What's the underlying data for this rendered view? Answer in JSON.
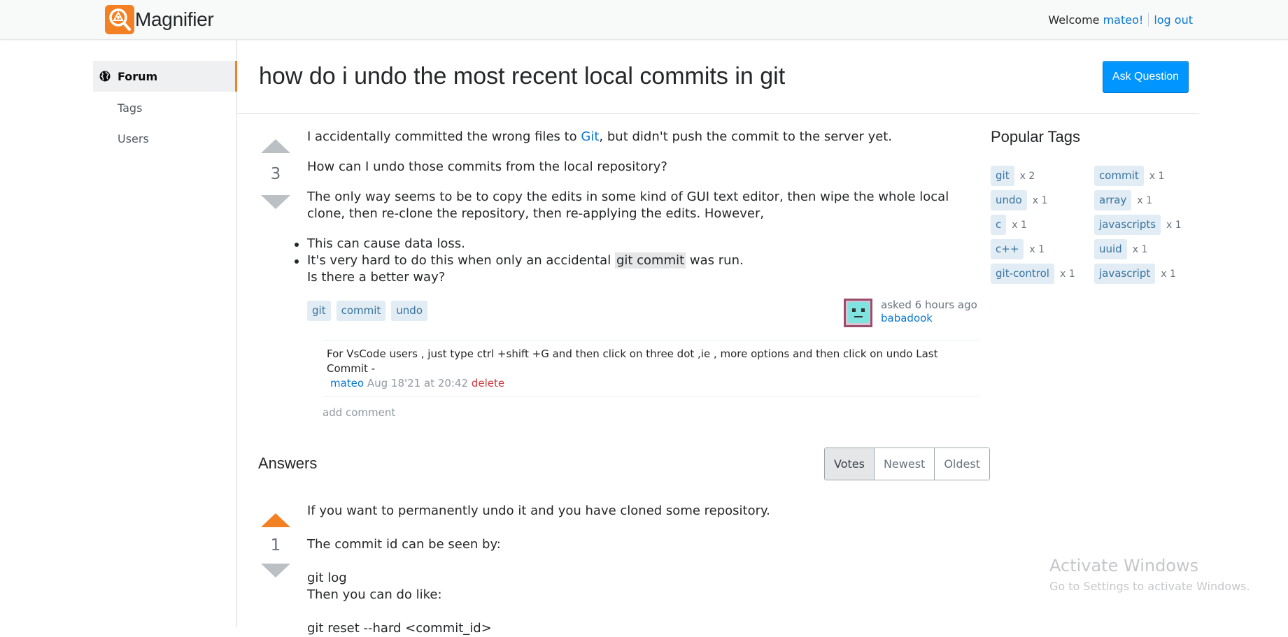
{
  "header": {
    "brand": "Magnifier",
    "welcome": "Welcome",
    "username": "mateo!",
    "logout": "log out"
  },
  "sidebar": {
    "items": [
      {
        "label": "Forum",
        "icon": "globe-icon",
        "active": true
      },
      {
        "label": "Tags",
        "active": false
      },
      {
        "label": "Users",
        "active": false
      }
    ]
  },
  "question": {
    "title": "how do i undo the most recent local commits in git",
    "ask_button": "Ask Question",
    "votes": "3",
    "body": {
      "p1_before": "I accidentally committed the wrong files to ",
      "p1_link": "Git",
      "p1_after": ", but didn't push the commit to the server yet.",
      "p2": "How can I undo those commits from the local repository?",
      "p3": "The only way seems to be to copy the edits in some kind of GUI text editor, then wipe the whole local clone, then re-clone the repository, then re-applying the edits. However,",
      "li1": "This can cause data loss.",
      "li2_before": "It's very hard to do this when only an accidental ",
      "li2_code": "git commit",
      "li2_after": " was run.",
      "li2_line2": "Is there a better way?"
    },
    "tags": [
      "git",
      "commit",
      "undo"
    ],
    "asked": "asked 6 hours ago",
    "author": "babadook",
    "comment": {
      "text": "For VsCode users , just type ctrl +shift +G and then click on three dot ,ie , more options and then click on undo Last Commit -",
      "user": "mateo",
      "date": "Aug 18'21 at 20:42",
      "delete": "delete"
    },
    "add_comment": "add comment"
  },
  "popular_tags": {
    "title": "Popular Tags",
    "tags": [
      {
        "name": "git",
        "count": "x 2"
      },
      {
        "name": "commit",
        "count": "x 1"
      },
      {
        "name": "undo",
        "count": "x 1"
      },
      {
        "name": "array",
        "count": "x 1"
      },
      {
        "name": "c",
        "count": "x 1"
      },
      {
        "name": "javascripts",
        "count": "x 1"
      },
      {
        "name": "c++",
        "count": "x 1"
      },
      {
        "name": "uuid",
        "count": "x 1"
      },
      {
        "name": "git-control",
        "count": "x 1"
      },
      {
        "name": "javascript",
        "count": "x 1"
      }
    ]
  },
  "answers": {
    "heading": "Answers",
    "sort_options": [
      "Votes",
      "Newest",
      "Oldest"
    ],
    "active_sort": "Votes",
    "first": {
      "votes": "1",
      "p1": "If you want to permanently undo it and you have cloned some repository.",
      "p2": "The commit id can be seen by:",
      "p3a": "git log",
      "p3b": "Then you can do like:",
      "p4": "git reset --hard <commit_id>"
    }
  },
  "watermark": {
    "line1": "Activate Windows",
    "line2": "Go to Settings to activate Windows."
  },
  "colors": {
    "accent": "#f48024",
    "link": "#0a78d1",
    "primary_button": "#0095ff",
    "tag_bg": "#e1ecf4",
    "delete": "#d1383d"
  }
}
